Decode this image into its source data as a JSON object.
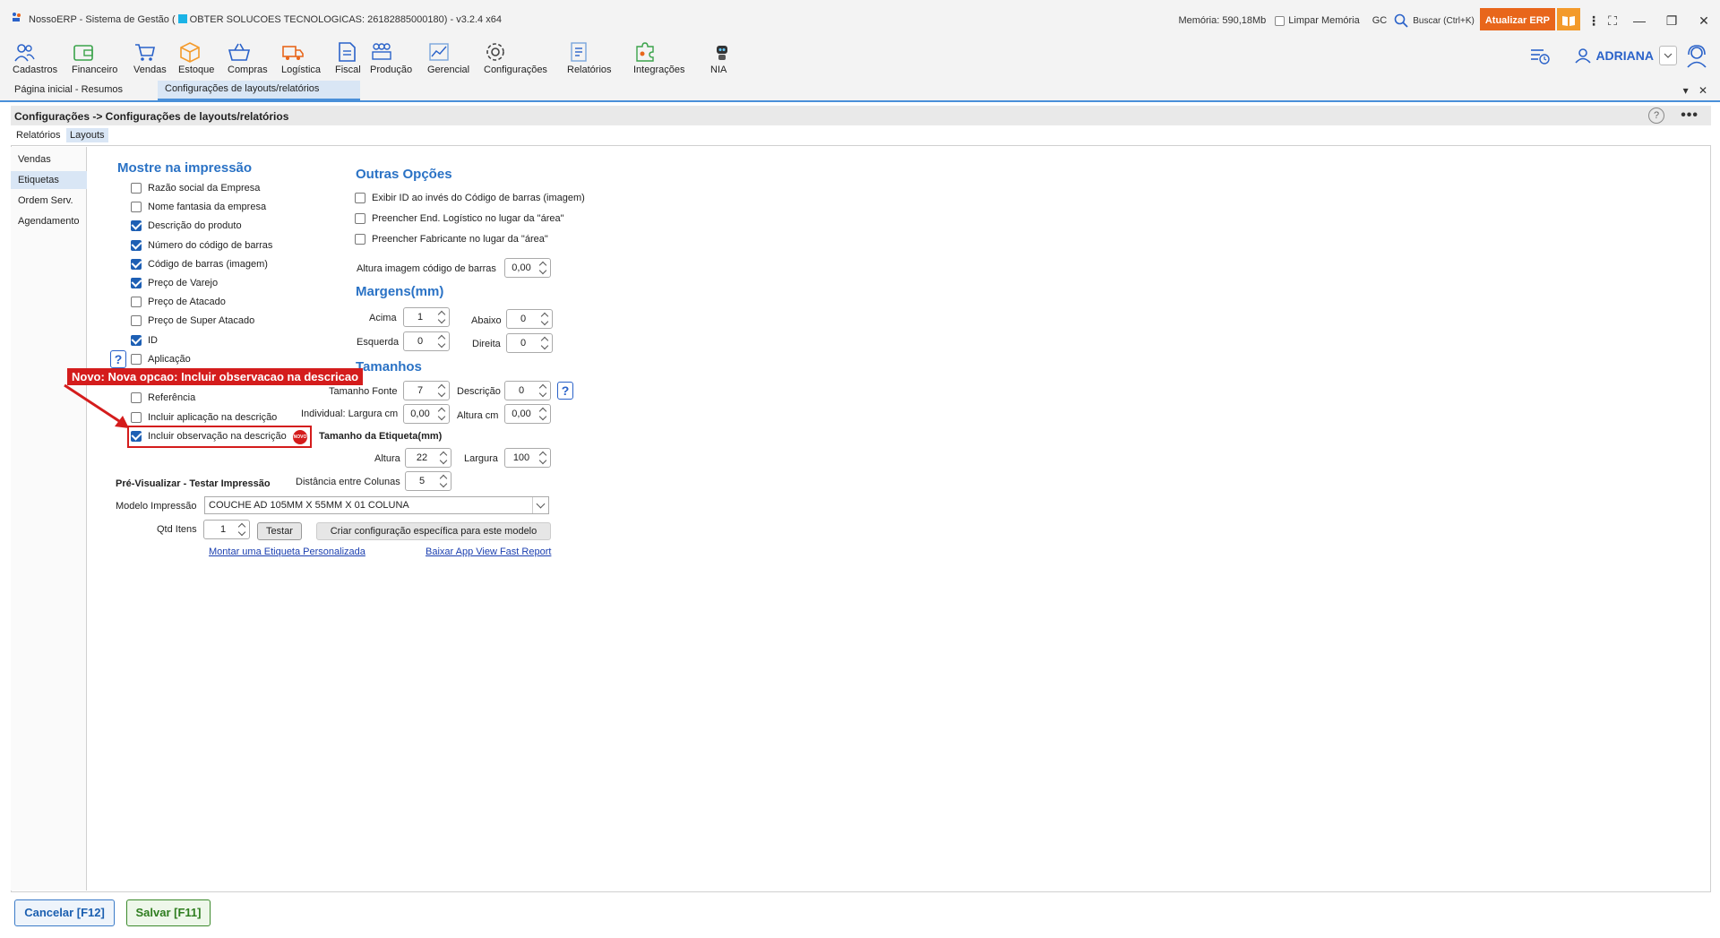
{
  "titlebar": {
    "app_name": "NossoERP - Sistema de Gestão (",
    "company": "OBTER SOLUCOES TECNOLOGICAS: 26182885000180)",
    "version": "- v3.2.4 x64",
    "memory": "Memória: 590,18Mb",
    "clear_memory": "Limpar Memória",
    "gc": "GC",
    "search": "Buscar (Ctrl+K)",
    "update_button": "Atualizar ERP"
  },
  "toolbar": {
    "items": [
      {
        "label": "Cadastros",
        "icon": "users-icon"
      },
      {
        "label": "Financeiro",
        "icon": "wallet-icon"
      },
      {
        "label": "Vendas",
        "icon": "cart-icon"
      },
      {
        "label": "Estoque",
        "icon": "box-icon"
      },
      {
        "label": "Compras",
        "icon": "basket-icon"
      },
      {
        "label": "Logística",
        "icon": "truck-icon"
      },
      {
        "label": "Fiscal",
        "icon": "document-icon"
      },
      {
        "label": "Produção",
        "icon": "factory-icon"
      },
      {
        "label": "Gerencial",
        "icon": "chart-icon"
      },
      {
        "label": "Configurações",
        "icon": "gear-icon"
      },
      {
        "label": "Relatórios",
        "icon": "report-icon"
      },
      {
        "label": "Integrações",
        "icon": "puzzle-icon"
      },
      {
        "label": "NIA",
        "icon": "robot-icon"
      }
    ],
    "user": "ADRIANA"
  },
  "tabs": [
    "Página inicial - Resumos",
    "Configurações de layouts/relatórios"
  ],
  "breadcrumb": "Configurações -> Configurações de layouts/relatórios",
  "subtabs": [
    "Relatórios",
    "Layouts"
  ],
  "sidenav": [
    "Vendas",
    "Etiquetas",
    "Ordem Serv.",
    "Agendamento"
  ],
  "show": {
    "title": "Mostre na impressão",
    "items": [
      {
        "label": "Razão social da Empresa",
        "checked": false
      },
      {
        "label": "Nome fantasia da empresa",
        "checked": false
      },
      {
        "label": "Descrição do produto",
        "checked": true
      },
      {
        "label": "Número do código de barras",
        "checked": true
      },
      {
        "label": "Código de barras (imagem)",
        "checked": true
      },
      {
        "label": "Preço de Varejo",
        "checked": true
      },
      {
        "label": "Preço de Atacado",
        "checked": false
      },
      {
        "label": "Preço de Super Atacado",
        "checked": false
      },
      {
        "label": "ID",
        "checked": true
      },
      {
        "label": "Aplicação",
        "checked": false
      },
      {
        "label": "Referência",
        "checked": false
      },
      {
        "label": "Incluir aplicação na descrição",
        "checked": false
      },
      {
        "label": "Incluir observação na descrição",
        "checked": true
      }
    ]
  },
  "other": {
    "title": "Outras Opções",
    "items": [
      "Exibir ID ao invés do Código de barras (imagem)",
      "Preencher End. Logístico no lugar da \"área\"",
      "Preencher Fabricante no lugar da \"área\""
    ],
    "barcode_height_label": "Altura imagem código de barras",
    "barcode_height": "0,00"
  },
  "margins": {
    "title": "Margens(mm)",
    "top_label": "Acima",
    "top": "1",
    "bottom_label": "Abaixo",
    "bottom": "0",
    "left_label": "Esquerda",
    "left": "0",
    "right_label": "Direita",
    "right": "0"
  },
  "sizes": {
    "title": "Tamanhos",
    "font_label": "Tamanho Fonte",
    "font": "7",
    "desc_label": "Descrição",
    "desc": "0",
    "width_label": "Individual: Largura cm",
    "width": "0,00",
    "height_label": "Altura cm",
    "height": "0,00"
  },
  "label_size": {
    "title": "Tamanho da Etiqueta(mm)",
    "height_label": "Altura",
    "height": "22",
    "width_label": "Largura",
    "width": "100",
    "columns_label": "Distância entre Colunas",
    "columns": "5"
  },
  "preview": {
    "title": "Pré-Visualizar - Testar Impressão",
    "model_label": "Modelo Impressão",
    "model": "COUCHE AD 105MM X 55MM X 01 COLUNA",
    "qty_label": "Qtd Itens",
    "qty": "1",
    "test_button": "Testar",
    "config_button": "Criar configuração específica para este modelo",
    "link_custom": "Montar uma Etiqueta Personalizada",
    "link_app": "Baixar App View Fast Report"
  },
  "annotation": {
    "banner": "Novo: Nova opcao: Incluir observacao na descricao",
    "badge": "NOVO"
  },
  "footer": {
    "cancel": "Cancelar [F12]",
    "save": "Salvar [F11]"
  }
}
